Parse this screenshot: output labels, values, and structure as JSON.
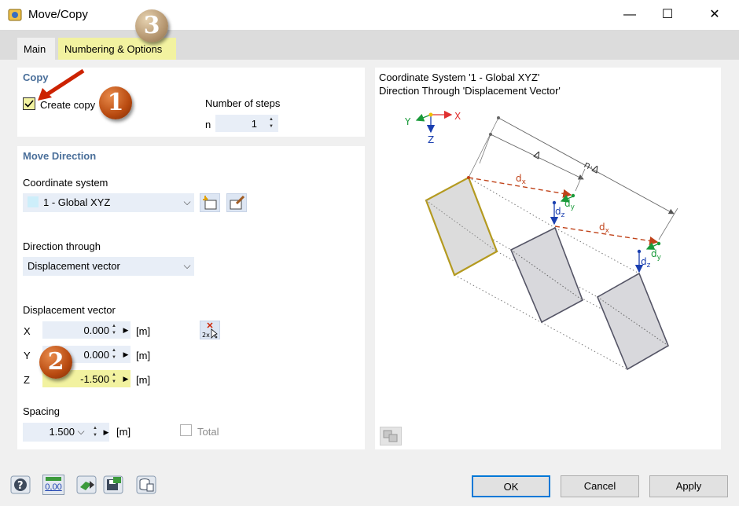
{
  "window": {
    "title": "Move/Copy",
    "minimize_glyph": "—",
    "maximize_glyph": "☐",
    "close_glyph": "✕"
  },
  "tabs": [
    {
      "label": "Main",
      "active": true
    },
    {
      "label": "Numbering & Options",
      "active": false
    }
  ],
  "copy": {
    "group_title": "Copy",
    "create_copy_label": "Create copy",
    "create_copy_checked": true,
    "steps_label": "Number of steps",
    "steps_symbol": "n",
    "steps_value": "1"
  },
  "move_direction": {
    "group_title": "Move Direction",
    "coord_system_label": "Coordinate system",
    "coord_system_value": "1 - Global XYZ",
    "direction_label": "Direction through",
    "direction_value": "Displacement vector",
    "displacement_label": "Displacement vector",
    "x_label": "X",
    "x_value": "0.000",
    "x_unit": "[m]",
    "y_label": "Y",
    "y_value": "0.000",
    "y_unit": "[m]",
    "z_label": "Z",
    "z_value": "-1.500",
    "z_unit": "[m]",
    "spacing_label": "Spacing",
    "spacing_value": "1.500",
    "spacing_unit": "[m]",
    "total_label": "Total",
    "total_checked": false
  },
  "preview": {
    "line1": "Coordinate System '1 - Global XYZ'",
    "line2": "Direction Through 'Displacement Vector'",
    "axis_x": "X",
    "axis_y": "Y",
    "axis_z": "Z",
    "delta_label": "Δ",
    "n_delta_label": "n·Δ",
    "dx_label": "d",
    "dx_sub": "x",
    "dy_label": "d",
    "dy_sub": "y",
    "dz_label": "d",
    "dz_sub": "z"
  },
  "badges": [
    "1",
    "2",
    "3"
  ],
  "footer": {
    "ok": "OK",
    "cancel": "Cancel",
    "apply": "Apply",
    "units_icon_text": "0,00"
  },
  "colors": {
    "accent_group_title": "#4a6f9a",
    "highlight_yellow": "#f2f2a0",
    "arrow_red": "#cc2200",
    "dx_orange": "#c0431a",
    "dy_green": "#1a9a3a",
    "dz_blue": "#1a3fb0"
  }
}
